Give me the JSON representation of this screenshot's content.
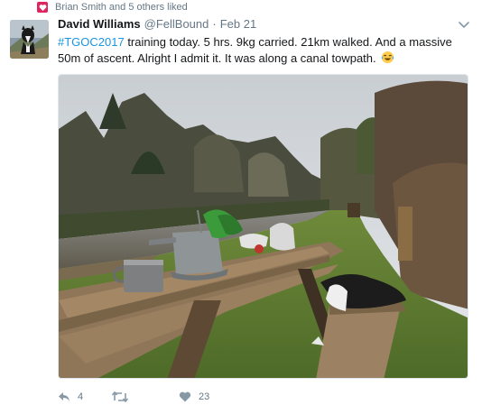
{
  "social_context": {
    "text": "Brian Smith and 5 others liked"
  },
  "tweet": {
    "author_name": "David Williams",
    "handle": "@FellBound",
    "separator": "·",
    "date": "Feb 21",
    "hashtag": "#TGOC2017",
    "text_line1": " training today. 5 hrs. 9kg carried. 21km walked. And a massive",
    "text_line2": "50m of ascent. Alright I admit it. It was along a canal towpath.",
    "emoji": "laughing-tears-emoji"
  },
  "photo": {
    "description_icon": "canal-picnic-photo"
  },
  "actions": {
    "reply_count": "4",
    "retweet_count": "",
    "like_count": "23"
  },
  "colors": {
    "like_badge": "#e0245e",
    "link": "#1b95e0",
    "muted": "#657786",
    "text": "#14171a"
  }
}
